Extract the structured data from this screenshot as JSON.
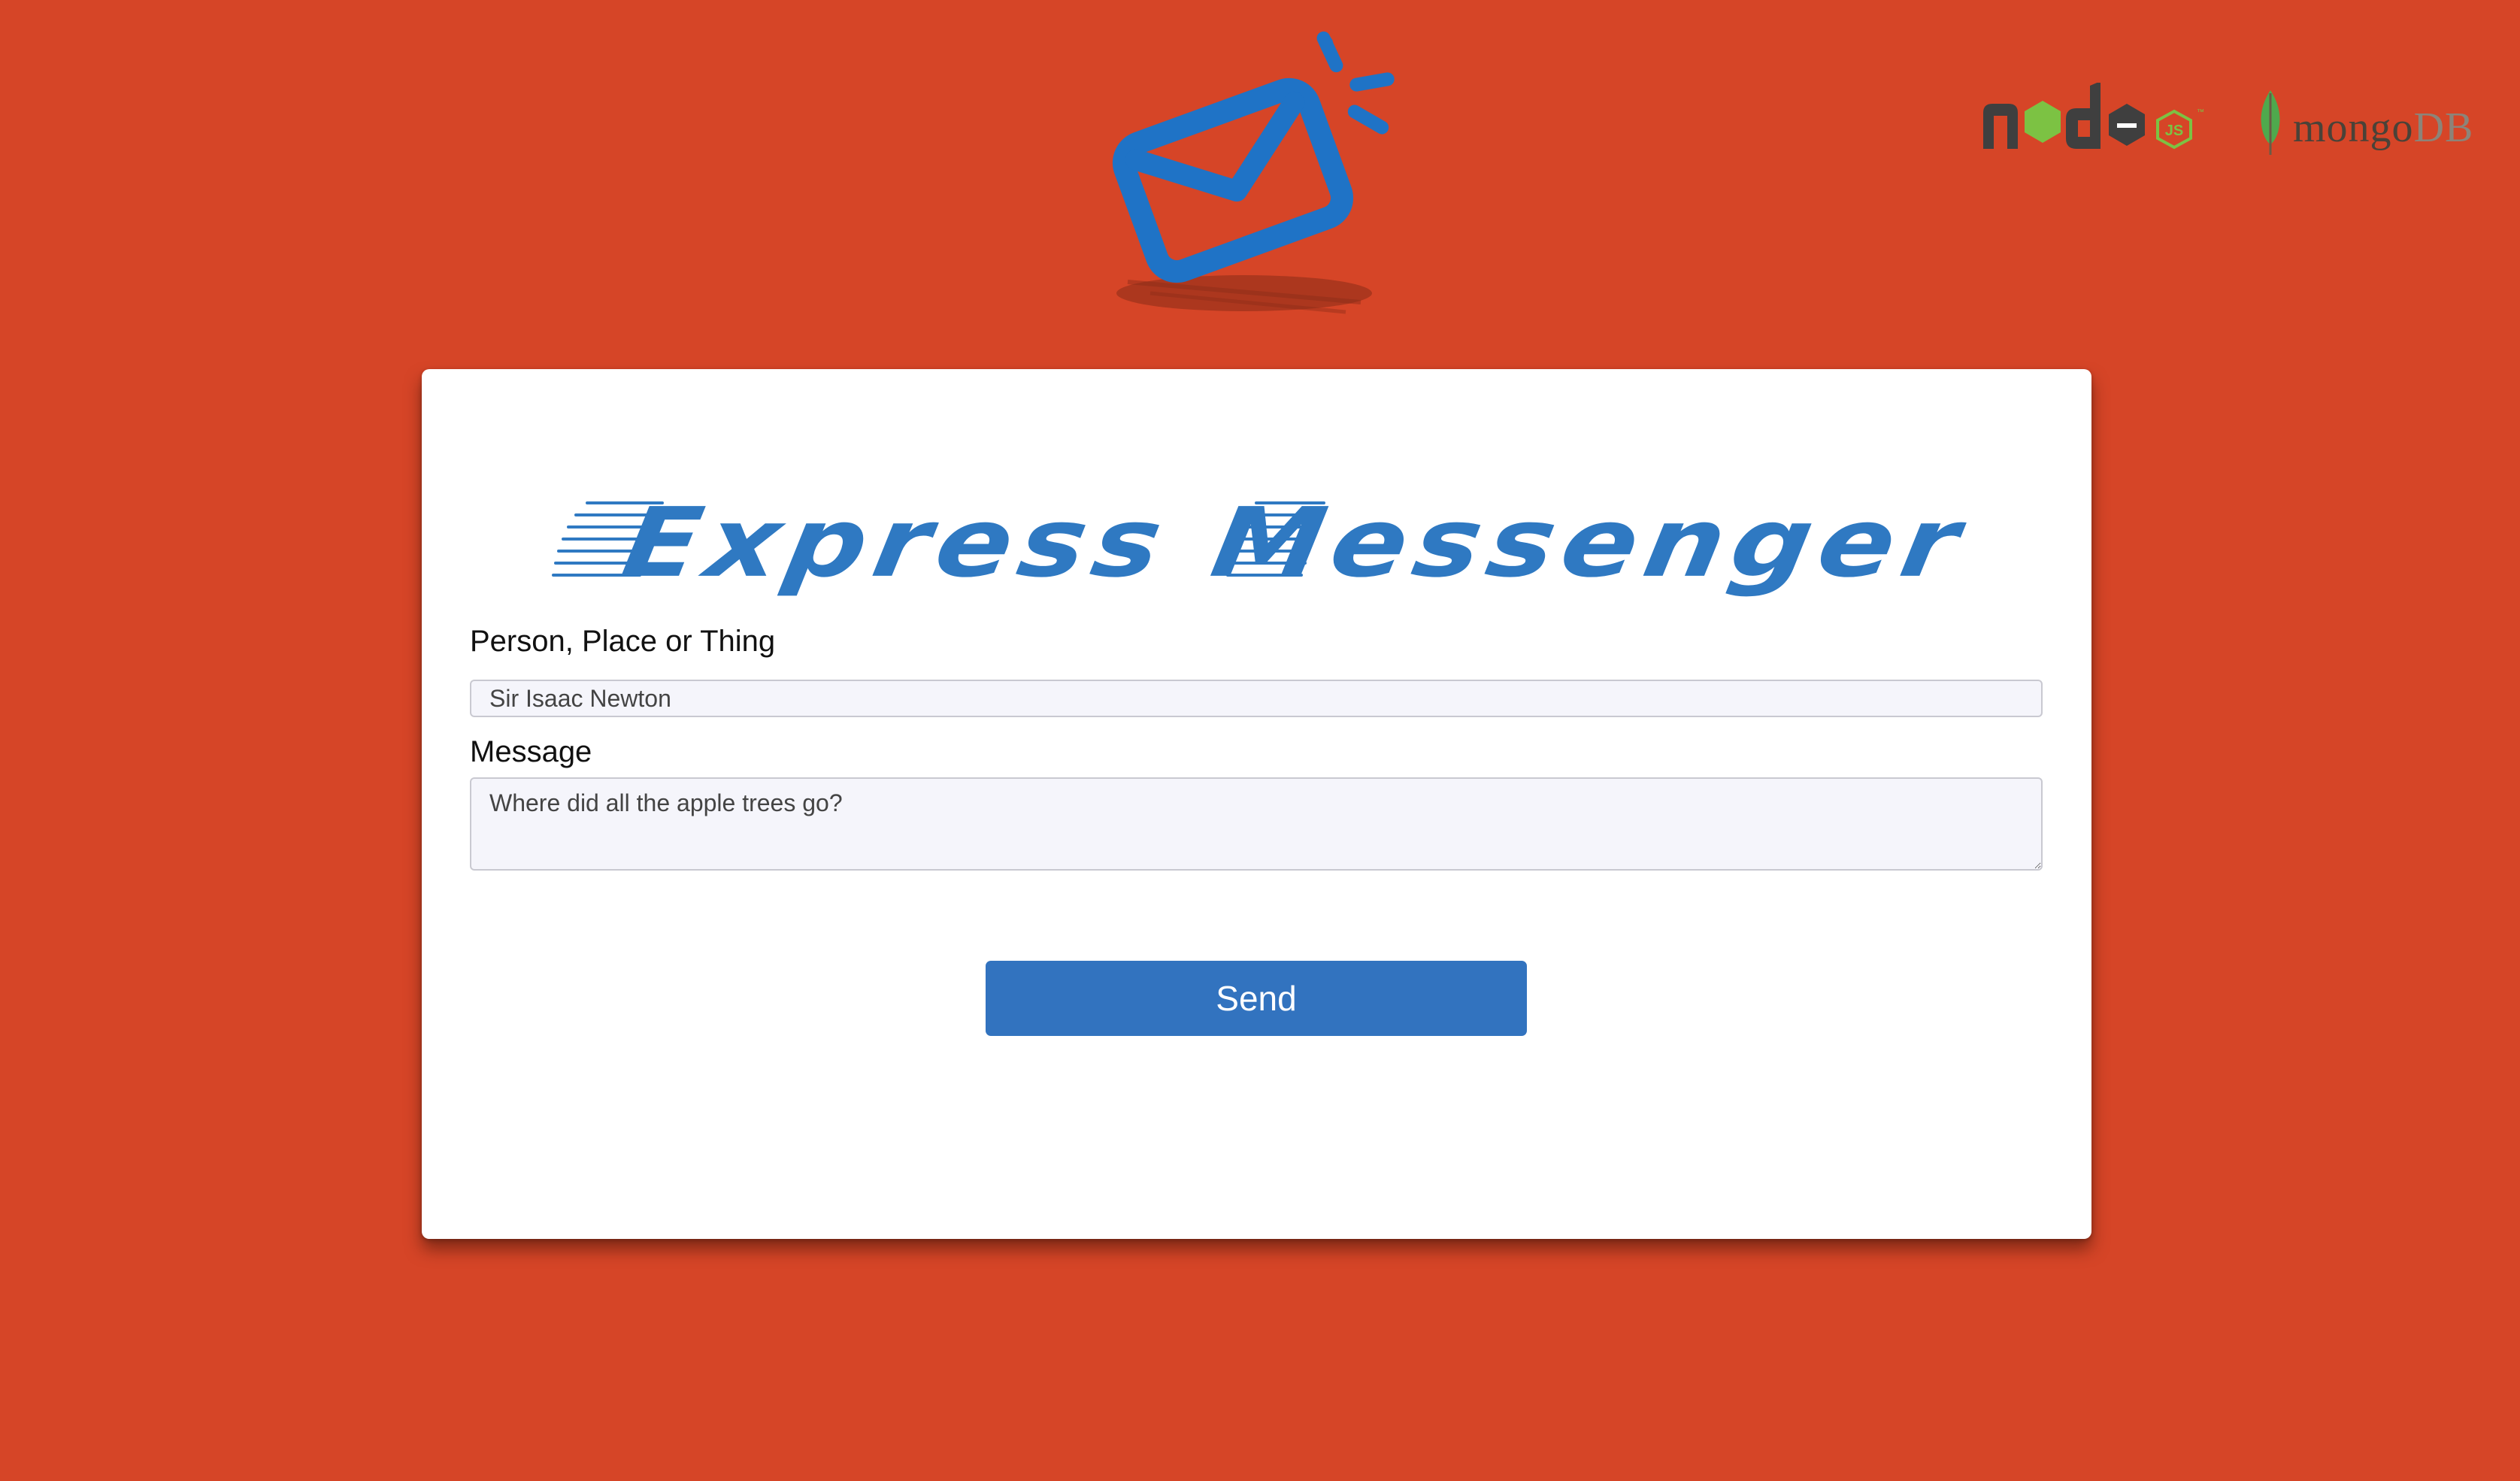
{
  "app": {
    "title": "Express Messenger"
  },
  "tech_logos": {
    "node_label": "node",
    "node_js_badge": "JS",
    "mongo_label_main": "mongo",
    "mongo_label_db": "DB"
  },
  "form": {
    "person_label": "Person, Place or Thing",
    "person_value": "Sir Isaac Newton",
    "message_label": "Message",
    "message_value": "Where did all the apple trees go?",
    "send_label": "Send"
  },
  "colors": {
    "background": "#d64527",
    "accent_blue": "#2f79c2",
    "button_blue": "#3273bf",
    "card": "#ffffff"
  },
  "icons": [
    "envelope-logo-icon",
    "nodejs-logo-icon",
    "mongodb-leaf-icon"
  ]
}
